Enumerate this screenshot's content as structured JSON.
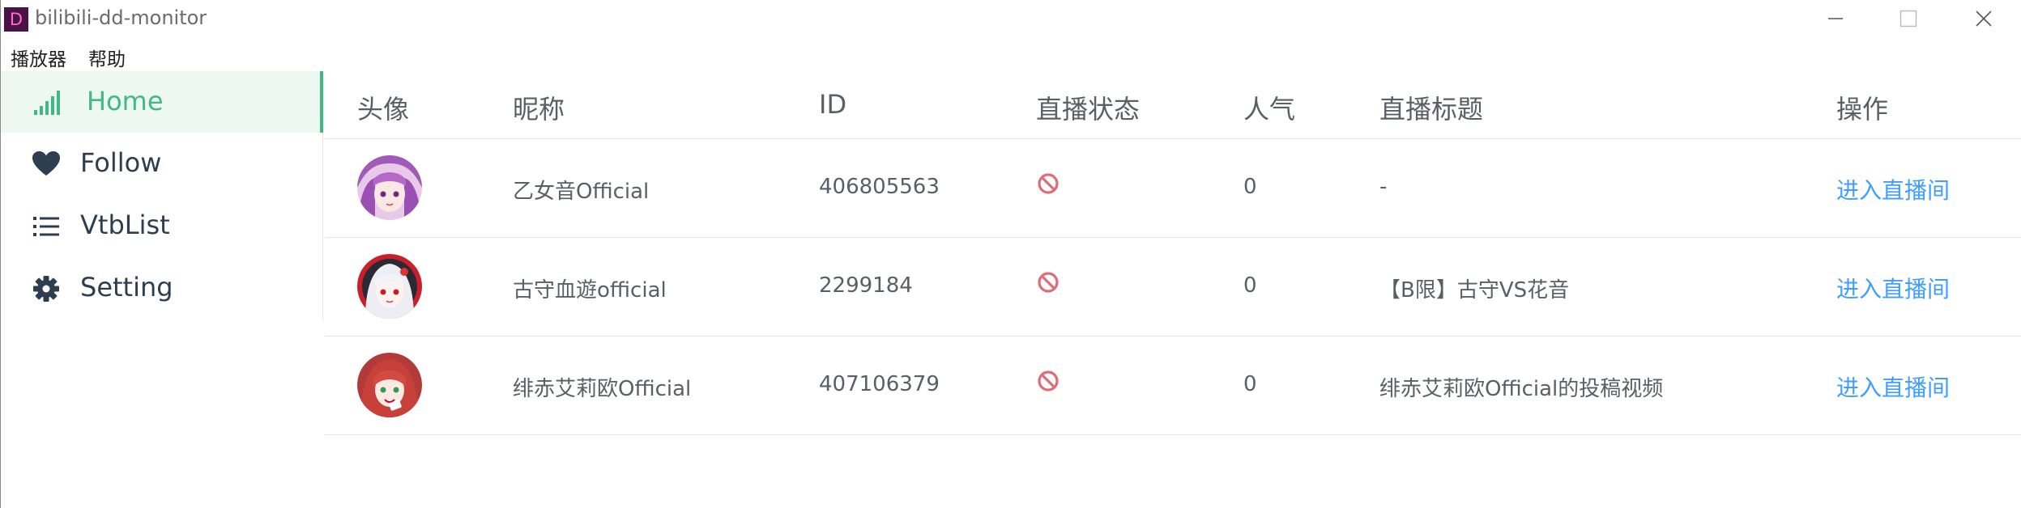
{
  "window": {
    "app_icon_letter": "D",
    "title": "bilibili-dd-monitor"
  },
  "menubar": {
    "items": [
      {
        "label": "播放器"
      },
      {
        "label": "帮助"
      }
    ]
  },
  "sidebar": {
    "items": [
      {
        "label": "Home",
        "icon": "signal-bars-icon",
        "active": true
      },
      {
        "label": "Follow",
        "icon": "heart-icon",
        "active": false
      },
      {
        "label": "VtbList",
        "icon": "list-icon",
        "active": false
      },
      {
        "label": "Setting",
        "icon": "gear-icon",
        "active": false
      }
    ]
  },
  "table": {
    "headers": {
      "avatar": "头像",
      "name": "昵称",
      "id": "ID",
      "status": "直播状态",
      "popularity": "人气",
      "live_title": "直播标题",
      "action": "操作"
    },
    "rows": [
      {
        "name": "乙女音Official",
        "id": "406805563",
        "status": "offline",
        "popularity": "0",
        "live_title": "-",
        "action": "进入直播间"
      },
      {
        "name": "古守血遊official",
        "id": "2299184",
        "status": "offline",
        "popularity": "0",
        "live_title": "【B限】古守VS花音",
        "action": "进入直播间"
      },
      {
        "name": "绯赤艾莉欧Official",
        "id": "407106379",
        "status": "offline",
        "popularity": "0",
        "live_title": "绯赤艾莉欧Official的投稿视频",
        "action": "进入直播间"
      }
    ]
  },
  "colors": {
    "accent": "#42b983",
    "link": "#409eff",
    "offline_status": "#e06c75",
    "active_bg": "#ecf8f1"
  }
}
